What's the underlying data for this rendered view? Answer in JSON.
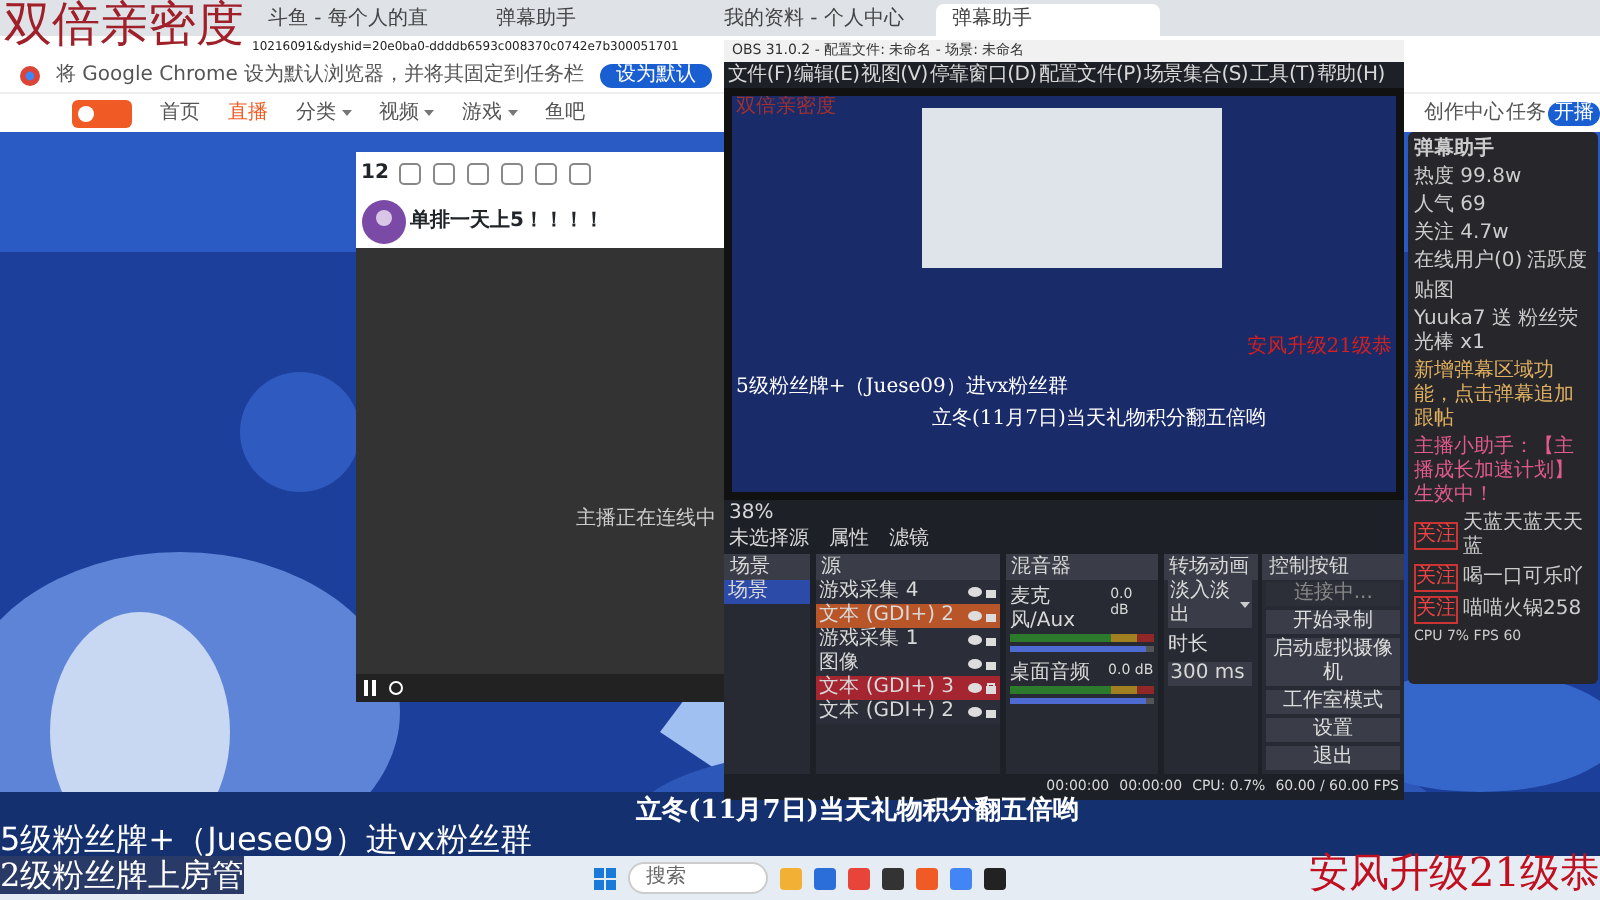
{
  "overlay": {
    "intimacy": "双倍亲密度",
    "fan_group": "5级粉丝牌+（Juese09）进vx粉丝群",
    "room_admin": "2级粉丝牌上房管",
    "upgrade": "安风升级21级恭",
    "banner": "立冬(11月7日)当天礼物积分翻五倍哟"
  },
  "browser": {
    "tabs": [
      {
        "title": "斗鱼 - 每个人的直",
        "selected": false
      },
      {
        "title": "弹幕助手",
        "selected": false
      },
      {
        "title": "我的资料 - 个人中心",
        "selected": false
      },
      {
        "title": "弹幕助手",
        "selected": true
      }
    ],
    "address": "10216091&dyshid=20e0ba0-ddddb6593c008370c0742e7b300051701",
    "infobar": {
      "text": "将 Google Chrome 设为默认浏览器，并将其固定到任务栏",
      "button": "设为默认"
    },
    "nav": [
      {
        "label": "首页",
        "selected": false,
        "dropdown": false
      },
      {
        "label": "直播",
        "selected": true,
        "dropdown": false
      },
      {
        "label": "分类",
        "selected": false,
        "dropdown": true
      },
      {
        "label": "视频",
        "selected": false,
        "dropdown": true
      },
      {
        "label": "游戏",
        "selected": false,
        "dropdown": true
      },
      {
        "label": "鱼吧",
        "selected": false,
        "dropdown": false
      }
    ],
    "nav_right": [
      "创作中心",
      "任务",
      "开播"
    ]
  },
  "room": {
    "score": "12",
    "title": "单排一天上5！！！！",
    "video_status": "主播正在连线中"
  },
  "obs": {
    "title": "OBS 31.0.2 - 配置文件: 未命名 - 场景: 未命名",
    "menu": [
      "文件(F)",
      "编辑(E)",
      "视图(V)",
      "停靠窗口(D)",
      "配置文件(P)",
      "场景集合(S)",
      "工具(T)",
      "帮助(H)"
    ],
    "preview_texts": {
      "intimacy": "双倍亲密度",
      "fan_group": "5级粉丝牌+（Juese09）进vx粉丝群",
      "banner": "立冬(11月7日)当天礼物积分翻五倍哟",
      "upgrade": "安风升级21级恭"
    },
    "zoom": "38%",
    "no_source": "未选择源",
    "source_buttons": [
      "属性",
      "滤镜"
    ],
    "docks": [
      "场景",
      "源",
      "混音器",
      "转场动画",
      "控制按钮"
    ],
    "scenes": [
      {
        "name": "场景",
        "selected": true
      }
    ],
    "sources": [
      {
        "name": "游戏采集 4",
        "color": "#2b2e38",
        "locked": false
      },
      {
        "name": "文本 (GDI+) 2",
        "color": "#b8562a",
        "locked": false
      },
      {
        "name": "游戏采集 1",
        "color": "#2b2e38",
        "locked": false
      },
      {
        "name": "图像",
        "color": "#2b2e38",
        "locked": false
      },
      {
        "name": "文本 (GDI+) 3",
        "color": "#a52530",
        "locked": true
      },
      {
        "name": "文本 (GDI+) 2",
        "color": "#2b2e38",
        "locked": false
      }
    ],
    "mixer": [
      {
        "name": "麦克风/Aux",
        "reading": "0.0 dB",
        "level": 0.95
      },
      {
        "name": "桌面音频",
        "reading": "0.0 dB",
        "level": 0.95
      }
    ],
    "transition": {
      "type": "淡入淡出",
      "duration_label": "时长",
      "duration": "300 ms"
    },
    "controls": [
      {
        "label": "连接中...",
        "disabled": true
      },
      {
        "label": "开始录制",
        "disabled": false
      },
      {
        "label": "启动虚拟摄像机",
        "disabled": false
      },
      {
        "label": "工作室模式",
        "disabled": false
      },
      {
        "label": "设置",
        "disabled": false
      },
      {
        "label": "退出",
        "disabled": false
      }
    ],
    "status": {
      "times": [
        "00:00:00",
        "00:00:00"
      ],
      "cpu": "CPU: 0.7%",
      "fps": "60.00 / 60.00 FPS"
    }
  },
  "danmu": {
    "title": "弹幕助手",
    "stats": [
      "热度 99.8w",
      "人气 69",
      "关注 4.7w"
    ],
    "tabs": [
      "在线用户(0)",
      "活跃度",
      "贴图"
    ],
    "gift": "Yuuka7 送 粉丝荧光棒 x1",
    "notice": "新增弹幕区域功能，点击弹幕追加跟帖",
    "helper": "主播小助手：【主播成长加速计划】生效中！",
    "fans": [
      {
        "badge": "关注",
        "name": "天蓝天蓝天天蓝"
      },
      {
        "badge": "关注",
        "name": "喝一口可乐吖"
      },
      {
        "badge": "关注",
        "name": "喵喵火锅258"
      }
    ],
    "footer": "CPU 7%  FPS 60"
  },
  "taskbar": {
    "search": "搜索"
  }
}
